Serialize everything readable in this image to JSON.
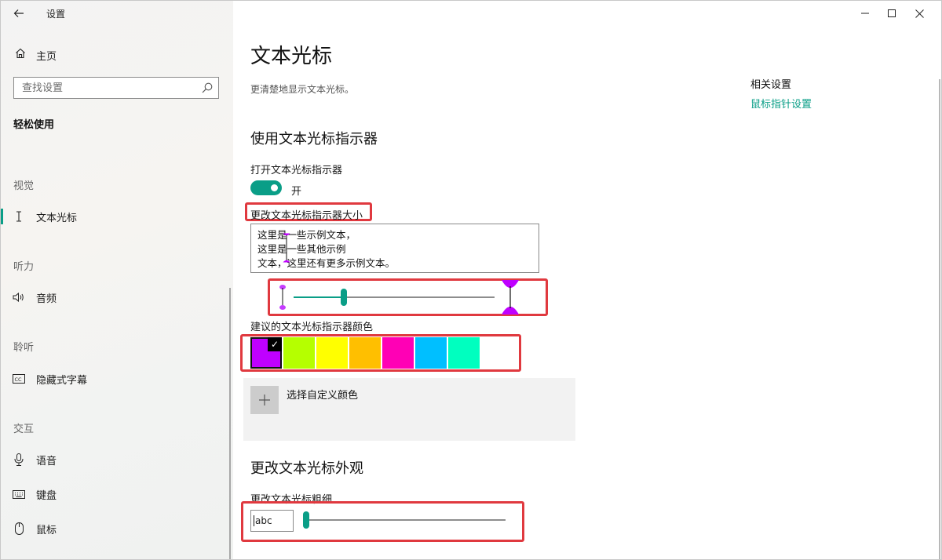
{
  "window": {
    "title": "设置",
    "controls": {
      "minimize_icon": "minimize-icon",
      "maximize_icon": "maximize-icon",
      "close_icon": "close-icon"
    }
  },
  "sidebar": {
    "back_icon": "arrow-left-icon",
    "home": {
      "label": "主页",
      "icon": "home-icon"
    },
    "search": {
      "placeholder": "查找设置",
      "icon": "search-icon"
    },
    "category_title": "轻松使用",
    "groups": [
      {
        "label": "视觉",
        "items": [
          {
            "label": "文本光标",
            "icon": "text-cursor-icon",
            "active": true
          }
        ]
      },
      {
        "label": "听力",
        "items": [
          {
            "label": "音频",
            "icon": "speaker-icon"
          }
        ]
      },
      {
        "label": "聆听",
        "items": [
          {
            "label": "隐藏式字幕",
            "icon": "closed-caption-icon"
          }
        ]
      },
      {
        "label": "交互",
        "items": [
          {
            "label": "语音",
            "icon": "microphone-icon"
          },
          {
            "label": "键盘",
            "icon": "keyboard-icon"
          },
          {
            "label": "鼠标",
            "icon": "mouse-icon"
          }
        ]
      }
    ]
  },
  "main": {
    "title": "文本光标",
    "description": "更清楚地显示文本光标。",
    "indicator": {
      "heading": "使用文本光标指示器",
      "toggle_label": "打开文本光标指示器",
      "toggle_state": "开",
      "toggle_on": true,
      "size_label": "更改文本光标指示器大小",
      "preview_lines": [
        "这里是一些示例文本，",
        "这里是一些其他示例",
        "文本，这里还有更多示例文本。"
      ],
      "size_slider_value_fraction": 0.24,
      "color_label": "建议的文本光标指示器颜色",
      "swatches": [
        {
          "color": "#bf00ff",
          "selected": true
        },
        {
          "color": "#b5ff00",
          "selected": false
        },
        {
          "color": "#ffff00",
          "selected": false
        },
        {
          "color": "#ffbf00",
          "selected": false
        },
        {
          "color": "#ff00b5",
          "selected": false
        },
        {
          "color": "#00bfff",
          "selected": false
        },
        {
          "color": "#00ffbf",
          "selected": false
        }
      ],
      "custom_color_label": "选择自定义颜色"
    },
    "appearance": {
      "heading": "更改文本光标外观",
      "thickness_label": "更改文本光标粗细",
      "preview_text": "abc",
      "thickness_slider_value_fraction": 0.0
    }
  },
  "related": {
    "title": "相关设置",
    "link": "鼠标指针设置"
  },
  "colors": {
    "accent": "#0a9e87",
    "highlight_box": "#e0393f",
    "cursor_indicator": "#bf00ff"
  }
}
